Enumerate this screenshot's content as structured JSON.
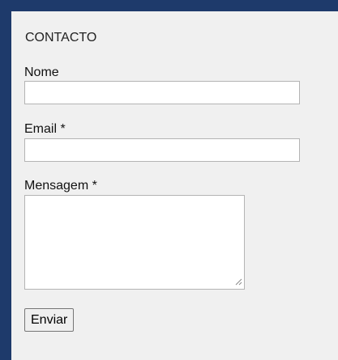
{
  "form": {
    "heading": "CONTACTO",
    "name_label": "Nome",
    "name_value": "",
    "email_label": "Email *",
    "email_value": "",
    "message_label": "Mensagem *",
    "message_value": "",
    "submit_label": "Enviar"
  },
  "colors": {
    "page_background": "#1e3a6b",
    "panel_background": "#f0f0f0",
    "field_border": "#b4b4b4"
  },
  "icons": {
    "textarea_resize": "resize-grip-icon"
  }
}
